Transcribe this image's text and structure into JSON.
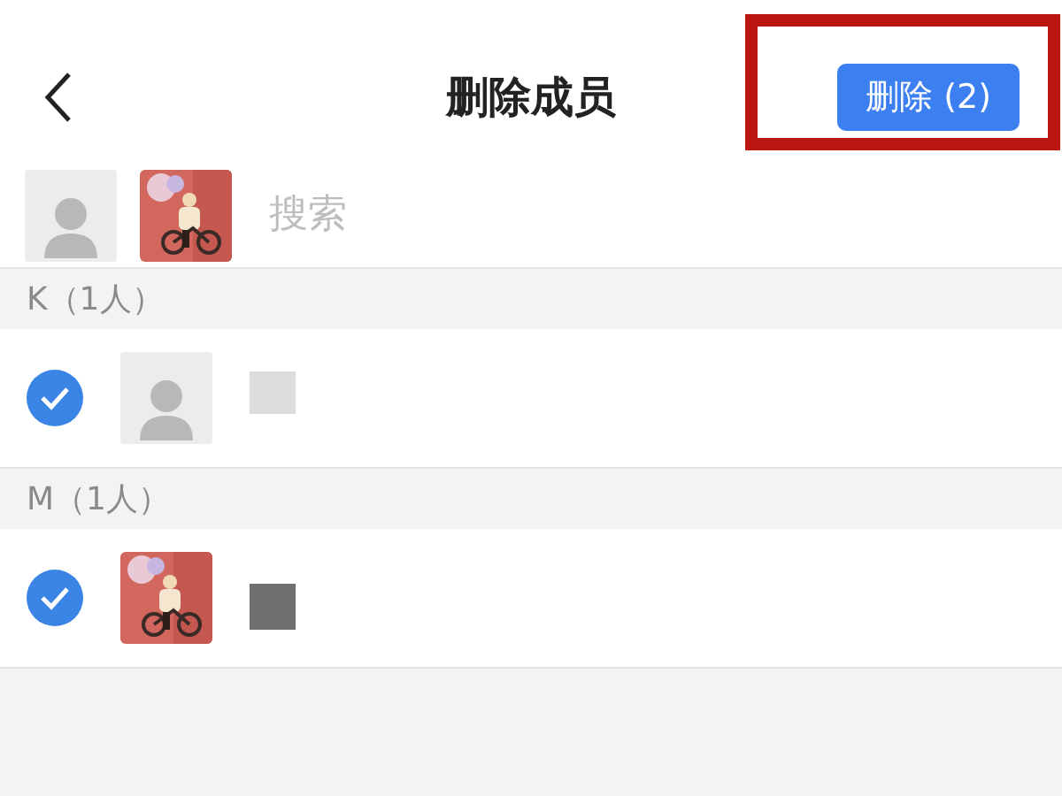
{
  "nav": {
    "title": "删除成员",
    "delete_button": "删除 (2)"
  },
  "selected_avatars": [
    {
      "kind": "default"
    },
    {
      "kind": "picture"
    }
  ],
  "search": {
    "placeholder": "搜索"
  },
  "sections": [
    {
      "header": "K（1人）",
      "members": [
        {
          "avatar": {
            "kind": "default"
          },
          "checked": true,
          "name_redaction": {
            "kind": "light"
          }
        }
      ]
    },
    {
      "header": "M（1人）",
      "members": [
        {
          "avatar": {
            "kind": "picture"
          },
          "checked": true,
          "name_redaction": {
            "kind": "dark"
          }
        }
      ]
    }
  ]
}
